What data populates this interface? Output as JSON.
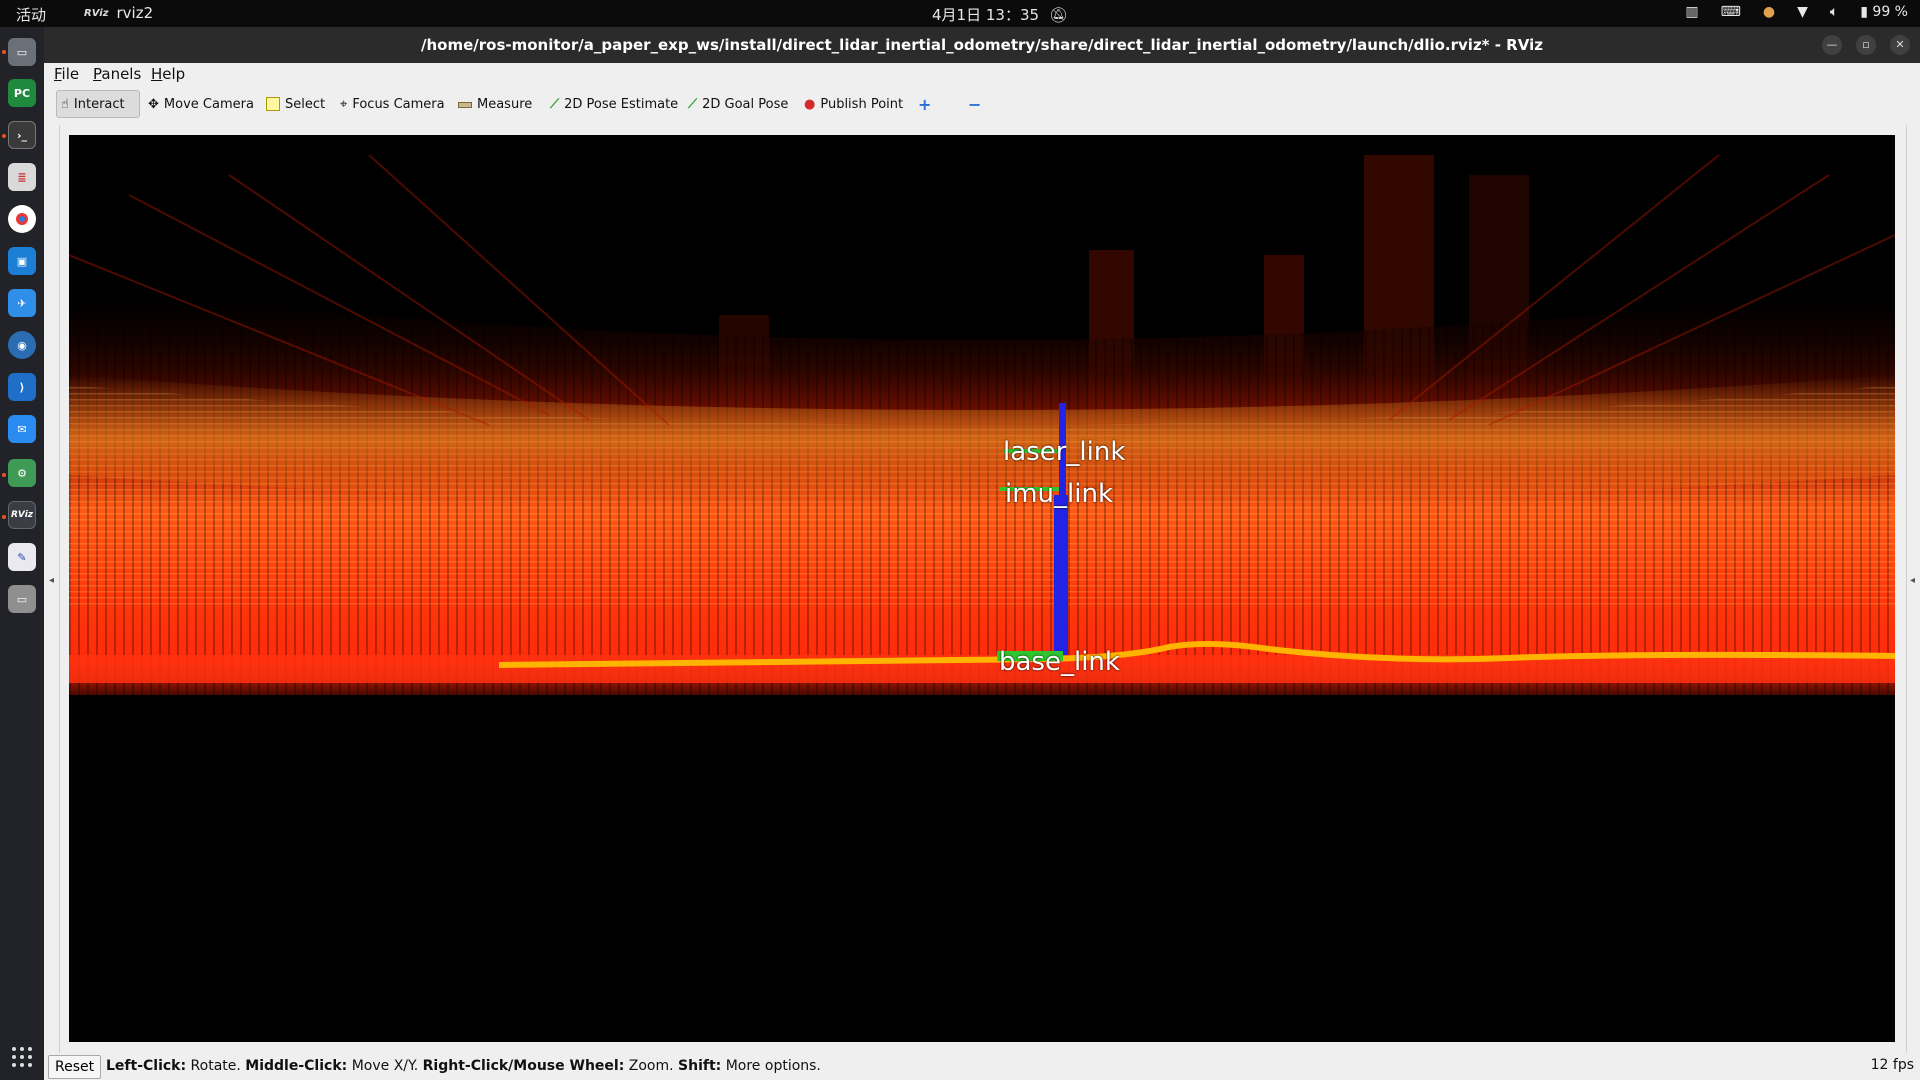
{
  "topbar": {
    "activities": "活动",
    "app_name": "rviz2",
    "app_badge": "RViz",
    "clock": "4月1日 13：35",
    "battery": "99 %"
  },
  "window": {
    "title": "/home/ros-monitor/a_paper_exp_ws/install/direct_lidar_inertial_odometry/share/direct_lidar_inertial_odometry/launch/dlio.rviz* - RViz"
  },
  "menu": {
    "file": "File",
    "panels": "Panels",
    "help": "Help"
  },
  "toolbar": {
    "interact": "Interact",
    "move_camera": "Move Camera",
    "select": "Select",
    "focus_camera": "Focus Camera",
    "measure": "Measure",
    "pose_estimate": "2D Pose Estimate",
    "goal_pose": "2D Goal Pose",
    "publish_point": "Publish Point",
    "add_tool": "+",
    "remove_tool": "−"
  },
  "scene": {
    "frames": {
      "laser": "laser_link",
      "imu": "imu_link",
      "base": "base_link"
    },
    "colors": {
      "cloud_hot": "#ff3a0a",
      "cloud_warm": "#ff8a12",
      "trajectory": "#ffb400",
      "axis_x": "#2ec52e",
      "axis_z": "#2323e6"
    }
  },
  "status": {
    "reset": "Reset",
    "left_click_key": "Left-Click:",
    "left_click_val": " Rotate. ",
    "middle_click_key": "Middle-Click:",
    "middle_click_val": " Move X/Y. ",
    "right_click_key": "Right-Click/Mouse Wheel:",
    "right_click_val": " Zoom. ",
    "shift_key": "Shift:",
    "shift_val": " More options.",
    "fps": "12 fps"
  },
  "dock": {
    "rviz_label": "RViz"
  }
}
